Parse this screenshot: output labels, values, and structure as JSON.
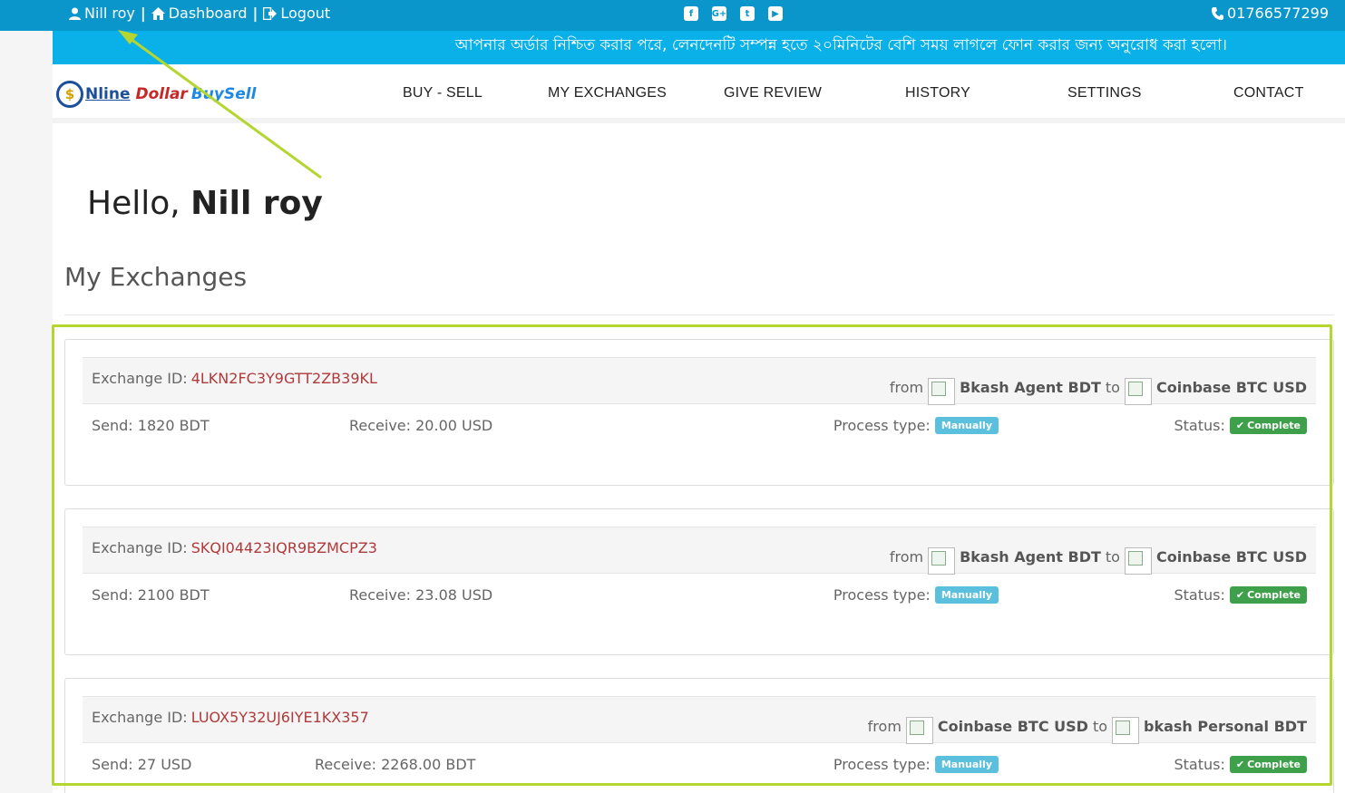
{
  "topbar": {
    "user_name": "Nill roy",
    "dashboard_label": "Dashboard",
    "logout_label": "Logout",
    "social_icons": [
      "facebook-icon",
      "google-plus-icon",
      "twitter-icon",
      "youtube-icon"
    ],
    "phone": "01766577299",
    "background_color": "#0a96cb"
  },
  "notice": {
    "text": "আপনার অর্ডার নিশ্চিত করার পরে, লেনদেনটি সম্পন্ন হতে ২০মিনিটের বেশি সময় লাগলে ফোন করার জন্য অনুরোধ করা হলো।",
    "background_color": "#0ab0e8"
  },
  "logo": {
    "coin": "$",
    "part1": "Nline",
    "part2": "Dollar",
    "part3": "BuySell"
  },
  "nav": {
    "items": [
      "BUY - SELL",
      "MY EXCHANGES",
      "GIVE REVIEW",
      "HISTORY",
      "SETTINGS",
      "CONTACT"
    ],
    "active": "MY EXCHANGES"
  },
  "greeting": {
    "prefix": "Hello,",
    "name": "Nill roy"
  },
  "section_title": "My Exchanges",
  "exchanges": [
    {
      "id_label": "Exchange ID:",
      "id": "4LKN2FC3Y9GTT2ZB39KL",
      "from_word": "from",
      "from": "Bkash Agent BDT",
      "to_word": "to",
      "to": "Coinbase BTC USD",
      "send": "Send: 1820 BDT",
      "receive": "Receive: 20.00 USD",
      "process_label": "Process type:",
      "process": "Manually",
      "status_label": "Status:",
      "status": "Complete"
    },
    {
      "id_label": "Exchange ID:",
      "id": "SKQI04423IQR9BZMCPZ3",
      "from_word": "from",
      "from": "Bkash Agent BDT",
      "to_word": "to",
      "to": "Coinbase BTC USD",
      "send": "Send: 2100 BDT",
      "receive": "Receive: 23.08 USD",
      "process_label": "Process type:",
      "process": "Manually",
      "status_label": "Status:",
      "status": "Complete"
    },
    {
      "id_label": "Exchange ID:",
      "id": "LUOX5Y32UJ6IYE1KX357",
      "from_word": "from",
      "from": "Coinbase BTC USD",
      "to_word": "to",
      "to": "bkash Personal BDT",
      "send": "Send: 27 USD",
      "receive": "Receive: 2268.00 BDT",
      "process_label": "Process type:",
      "process": "Manually",
      "status_label": "Status:",
      "status": "Complete"
    }
  ],
  "annotation_color": "#b5d531"
}
